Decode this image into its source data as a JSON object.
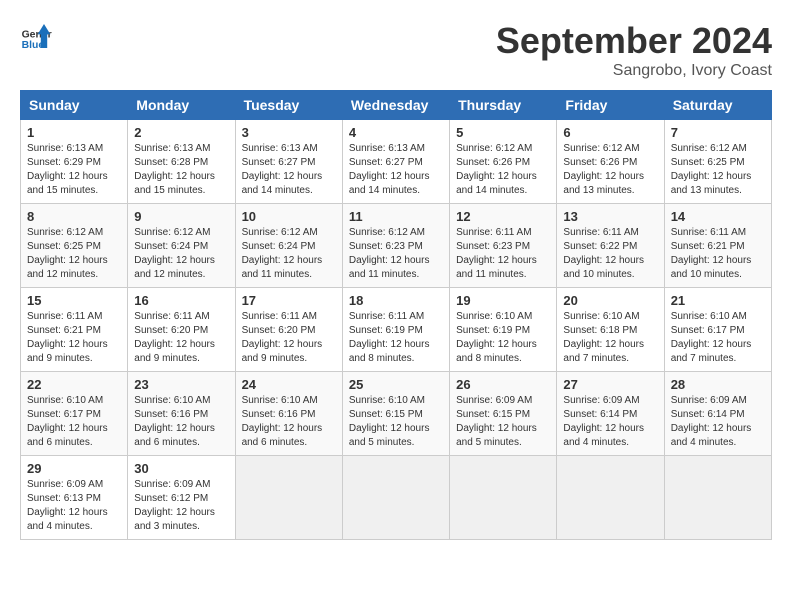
{
  "header": {
    "logo_general": "General",
    "logo_blue": "Blue",
    "month_title": "September 2024",
    "subtitle": "Sangrobo, Ivory Coast"
  },
  "weekdays": [
    "Sunday",
    "Monday",
    "Tuesday",
    "Wednesday",
    "Thursday",
    "Friday",
    "Saturday"
  ],
  "weeks": [
    [
      {
        "day": "1",
        "info": "Sunrise: 6:13 AM\nSunset: 6:29 PM\nDaylight: 12 hours\nand 15 minutes."
      },
      {
        "day": "2",
        "info": "Sunrise: 6:13 AM\nSunset: 6:28 PM\nDaylight: 12 hours\nand 15 minutes."
      },
      {
        "day": "3",
        "info": "Sunrise: 6:13 AM\nSunset: 6:27 PM\nDaylight: 12 hours\nand 14 minutes."
      },
      {
        "day": "4",
        "info": "Sunrise: 6:13 AM\nSunset: 6:27 PM\nDaylight: 12 hours\nand 14 minutes."
      },
      {
        "day": "5",
        "info": "Sunrise: 6:12 AM\nSunset: 6:26 PM\nDaylight: 12 hours\nand 14 minutes."
      },
      {
        "day": "6",
        "info": "Sunrise: 6:12 AM\nSunset: 6:26 PM\nDaylight: 12 hours\nand 13 minutes."
      },
      {
        "day": "7",
        "info": "Sunrise: 6:12 AM\nSunset: 6:25 PM\nDaylight: 12 hours\nand 13 minutes."
      }
    ],
    [
      {
        "day": "8",
        "info": "Sunrise: 6:12 AM\nSunset: 6:25 PM\nDaylight: 12 hours\nand 12 minutes."
      },
      {
        "day": "9",
        "info": "Sunrise: 6:12 AM\nSunset: 6:24 PM\nDaylight: 12 hours\nand 12 minutes."
      },
      {
        "day": "10",
        "info": "Sunrise: 6:12 AM\nSunset: 6:24 PM\nDaylight: 12 hours\nand 11 minutes."
      },
      {
        "day": "11",
        "info": "Sunrise: 6:12 AM\nSunset: 6:23 PM\nDaylight: 12 hours\nand 11 minutes."
      },
      {
        "day": "12",
        "info": "Sunrise: 6:11 AM\nSunset: 6:23 PM\nDaylight: 12 hours\nand 11 minutes."
      },
      {
        "day": "13",
        "info": "Sunrise: 6:11 AM\nSunset: 6:22 PM\nDaylight: 12 hours\nand 10 minutes."
      },
      {
        "day": "14",
        "info": "Sunrise: 6:11 AM\nSunset: 6:21 PM\nDaylight: 12 hours\nand 10 minutes."
      }
    ],
    [
      {
        "day": "15",
        "info": "Sunrise: 6:11 AM\nSunset: 6:21 PM\nDaylight: 12 hours\nand 9 minutes."
      },
      {
        "day": "16",
        "info": "Sunrise: 6:11 AM\nSunset: 6:20 PM\nDaylight: 12 hours\nand 9 minutes."
      },
      {
        "day": "17",
        "info": "Sunrise: 6:11 AM\nSunset: 6:20 PM\nDaylight: 12 hours\nand 9 minutes."
      },
      {
        "day": "18",
        "info": "Sunrise: 6:11 AM\nSunset: 6:19 PM\nDaylight: 12 hours\nand 8 minutes."
      },
      {
        "day": "19",
        "info": "Sunrise: 6:10 AM\nSunset: 6:19 PM\nDaylight: 12 hours\nand 8 minutes."
      },
      {
        "day": "20",
        "info": "Sunrise: 6:10 AM\nSunset: 6:18 PM\nDaylight: 12 hours\nand 7 minutes."
      },
      {
        "day": "21",
        "info": "Sunrise: 6:10 AM\nSunset: 6:17 PM\nDaylight: 12 hours\nand 7 minutes."
      }
    ],
    [
      {
        "day": "22",
        "info": "Sunrise: 6:10 AM\nSunset: 6:17 PM\nDaylight: 12 hours\nand 6 minutes."
      },
      {
        "day": "23",
        "info": "Sunrise: 6:10 AM\nSunset: 6:16 PM\nDaylight: 12 hours\nand 6 minutes."
      },
      {
        "day": "24",
        "info": "Sunrise: 6:10 AM\nSunset: 6:16 PM\nDaylight: 12 hours\nand 6 minutes."
      },
      {
        "day": "25",
        "info": "Sunrise: 6:10 AM\nSunset: 6:15 PM\nDaylight: 12 hours\nand 5 minutes."
      },
      {
        "day": "26",
        "info": "Sunrise: 6:09 AM\nSunset: 6:15 PM\nDaylight: 12 hours\nand 5 minutes."
      },
      {
        "day": "27",
        "info": "Sunrise: 6:09 AM\nSunset: 6:14 PM\nDaylight: 12 hours\nand 4 minutes."
      },
      {
        "day": "28",
        "info": "Sunrise: 6:09 AM\nSunset: 6:14 PM\nDaylight: 12 hours\nand 4 minutes."
      }
    ],
    [
      {
        "day": "29",
        "info": "Sunrise: 6:09 AM\nSunset: 6:13 PM\nDaylight: 12 hours\nand 4 minutes."
      },
      {
        "day": "30",
        "info": "Sunrise: 6:09 AM\nSunset: 6:12 PM\nDaylight: 12 hours\nand 3 minutes."
      },
      null,
      null,
      null,
      null,
      null
    ]
  ]
}
